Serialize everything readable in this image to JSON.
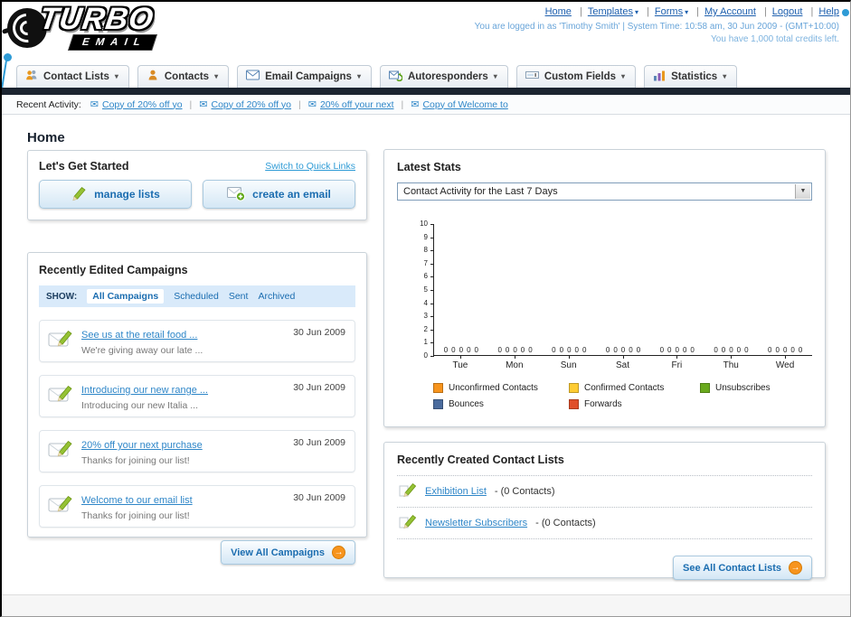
{
  "icons": {
    "arrow_right": "→",
    "envelope": "✉",
    "chevron_down": "▾",
    "select_arrow": "▼"
  },
  "header": {
    "logo_title": "TURBO",
    "logo_subtitle": "EMAIL",
    "links": [
      "Home",
      "Templates",
      "Forms",
      "My Account",
      "Logout",
      "Help"
    ],
    "login_info": "You are logged in as 'Timothy Smith' | System Time: 10:58 am, 30 Jun 2009 - (GMT+10:00)",
    "credits_info": "You have 1,000 total credits left."
  },
  "nav": {
    "items": [
      {
        "label": "Contact Lists"
      },
      {
        "label": "Contacts"
      },
      {
        "label": "Email Campaigns"
      },
      {
        "label": "Autoresponders"
      },
      {
        "label": "Custom Fields"
      },
      {
        "label": "Statistics"
      }
    ]
  },
  "recent_activity": {
    "label": "Recent Activity:",
    "items": [
      "Copy of 20% off yo",
      "Copy of 20% off yo",
      "20% off your next",
      "Copy of Welcome to"
    ]
  },
  "page": {
    "title": "Home"
  },
  "get_started": {
    "title": "Let's Get Started",
    "switch_link": "Switch to Quick Links",
    "manage_lists_label": "manage lists",
    "create_email_label": "create an email"
  },
  "campaigns": {
    "title": "Recently Edited Campaigns",
    "show_label": "SHOW:",
    "tabs": [
      "All Campaigns",
      "Scheduled",
      "Sent",
      "Archived"
    ],
    "selected_tab": "All Campaigns",
    "items": [
      {
        "title": "See us at the retail food ...",
        "subtitle": "We're giving away our late ...",
        "date": "30 Jun 2009"
      },
      {
        "title": "Introducing our new range ...",
        "subtitle": "Introducing our new Italia ...",
        "date": "30 Jun 2009"
      },
      {
        "title": "20% off your next purchase",
        "subtitle": "Thanks for joining our list!",
        "date": "30 Jun 2009"
      },
      {
        "title": "Welcome to our email list",
        "subtitle": "Thanks for joining our list!",
        "date": "30 Jun 2009"
      }
    ],
    "view_all_label": "View All Campaigns"
  },
  "stats": {
    "title": "Latest Stats",
    "selected_option": "Contact Activity for the Last 7 Days",
    "chart_data": {
      "type": "bar",
      "title": "Contact Activity for the Last 7 Days",
      "categories": [
        "Tue",
        "Mon",
        "Sun",
        "Sat",
        "Fri",
        "Thu",
        "Wed"
      ],
      "series": [
        {
          "name": "Unconfirmed Contacts",
          "color": "#f7941d",
          "values": [
            0,
            0,
            0,
            0,
            0,
            0,
            0
          ]
        },
        {
          "name": "Confirmed Contacts",
          "color": "#ffcc33",
          "values": [
            0,
            0,
            0,
            0,
            0,
            0,
            0
          ]
        },
        {
          "name": "Unsubscribes",
          "color": "#6aaa1e",
          "values": [
            0,
            0,
            0,
            0,
            0,
            0,
            0
          ]
        },
        {
          "name": "Bounces",
          "color": "#4a6b9d",
          "values": [
            0,
            0,
            0,
            0,
            0,
            0,
            0
          ]
        },
        {
          "name": "Forwards",
          "color": "#e04f2a",
          "values": [
            0,
            0,
            0,
            0,
            0,
            0,
            0
          ]
        }
      ],
      "ylim": [
        0,
        10
      ],
      "grid": false,
      "legend_position": "bottom"
    }
  },
  "contact_lists": {
    "title": "Recently Created Contact Lists",
    "items": [
      {
        "name": "Exhibition List",
        "suffix": "- (0 Contacts)"
      },
      {
        "name": "Newsletter Subscribers",
        "suffix": "- (0 Contacts)"
      }
    ],
    "see_all_label": "See All Contact Lists"
  }
}
